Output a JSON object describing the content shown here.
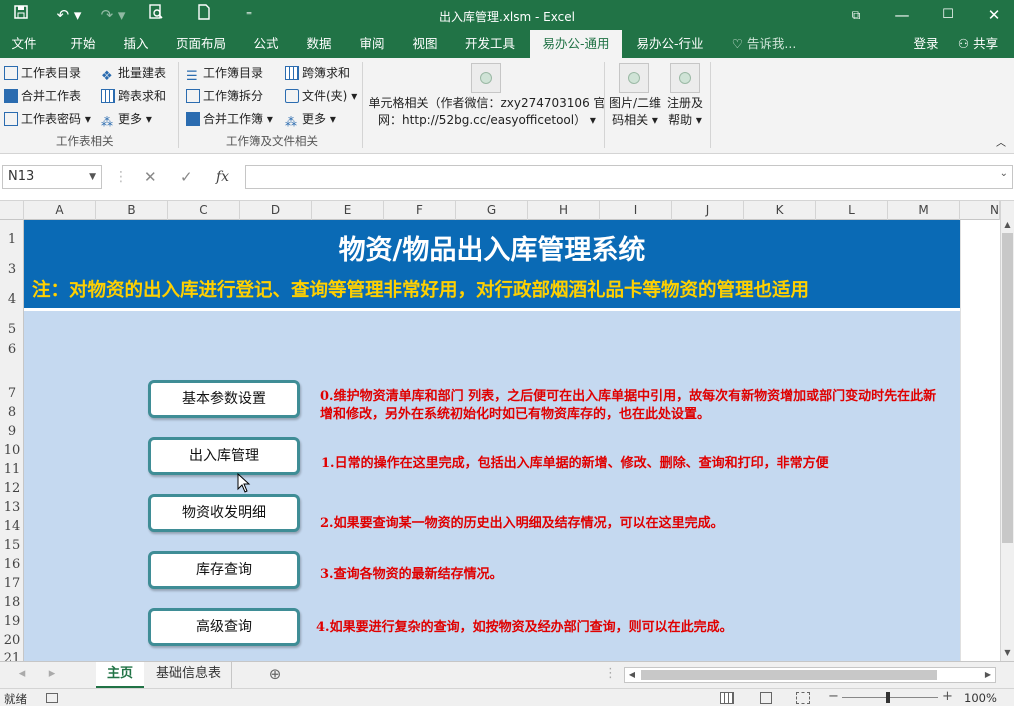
{
  "window": {
    "title": "出入库管理.xlsm - Excel"
  },
  "menu_tabs": [
    "文件",
    "开始",
    "插入",
    "页面布局",
    "公式",
    "数据",
    "审阅",
    "视图",
    "开发工具",
    "易办公-通用",
    "易办公-行业"
  ],
  "tell_me": "告诉我...",
  "login": "登录",
  "share": "共享",
  "ribbon": {
    "group1": {
      "items": [
        "工作表目录",
        "批量建表",
        "合并工作表",
        "跨表求和",
        "工作表密码",
        "更多"
      ],
      "label": "工作表相关"
    },
    "group2": {
      "items": [
        "工作簿目录",
        "跨簿求和",
        "工作簿拆分",
        "文件(夹)",
        "合并工作簿",
        "更多"
      ],
      "label": "工作簿及文件相关"
    },
    "cell_related": "单元格相关（作者微信：zxy274703106 官网：http://52bg.cc/easyofficetool）",
    "image_qr": "图片/二维码相关",
    "register_help": "注册及帮助"
  },
  "formula_bar": {
    "name_box": "N13",
    "fx": "fx"
  },
  "columns": [
    "A",
    "B",
    "C",
    "D",
    "E",
    "F",
    "G",
    "H",
    "I",
    "J",
    "K",
    "L",
    "M",
    "N"
  ],
  "rows": [
    "1",
    "3",
    "4",
    "5",
    "6",
    "7",
    "8",
    "9",
    "10",
    "11",
    "12",
    "13",
    "14",
    "15",
    "16",
    "17",
    "18",
    "19",
    "20",
    "21"
  ],
  "sheet": {
    "title": "物资/物品出入库管理系统",
    "note": "注：对物资的出入库进行登记、查询等管理非常好用，对行政部烟酒礼品卡等物资的管理也适用",
    "buttons": [
      "基本参数设置",
      "出入库管理",
      "物资收发明细",
      "库存查询",
      "高级查询"
    ],
    "descriptions": [
      "0.维护物资清单库和部门 列表，之后便可在出入库单据中引用，故每次有新物资增加或部门变动时先在此新增和修改，另外在系统初始化时如已有物资库存的，也在此处设置。",
      "1.日常的操作在这里完成，包括出入库单据的新增、修改、删除、查询和打印，非常方便",
      "2.如果要查询某一物资的历史出入明细及结存情况，可以在这里完成。",
      "3.查询各物资的最新结存情况。",
      "4.如果要进行复杂的查询，如按物资及经办部门查询，则可以在此完成。"
    ]
  },
  "sheet_tabs": [
    "主页",
    "基础信息表"
  ],
  "status": {
    "ready": "就绪",
    "zoom": "100%"
  },
  "colors": {
    "excel_green": "#217346",
    "banner_blue": "#0a6ab5",
    "note_yellow": "#ffd000",
    "panel_blue": "#c5d9f0",
    "desc_red": "#e00000",
    "button_border": "#3f8d96"
  }
}
